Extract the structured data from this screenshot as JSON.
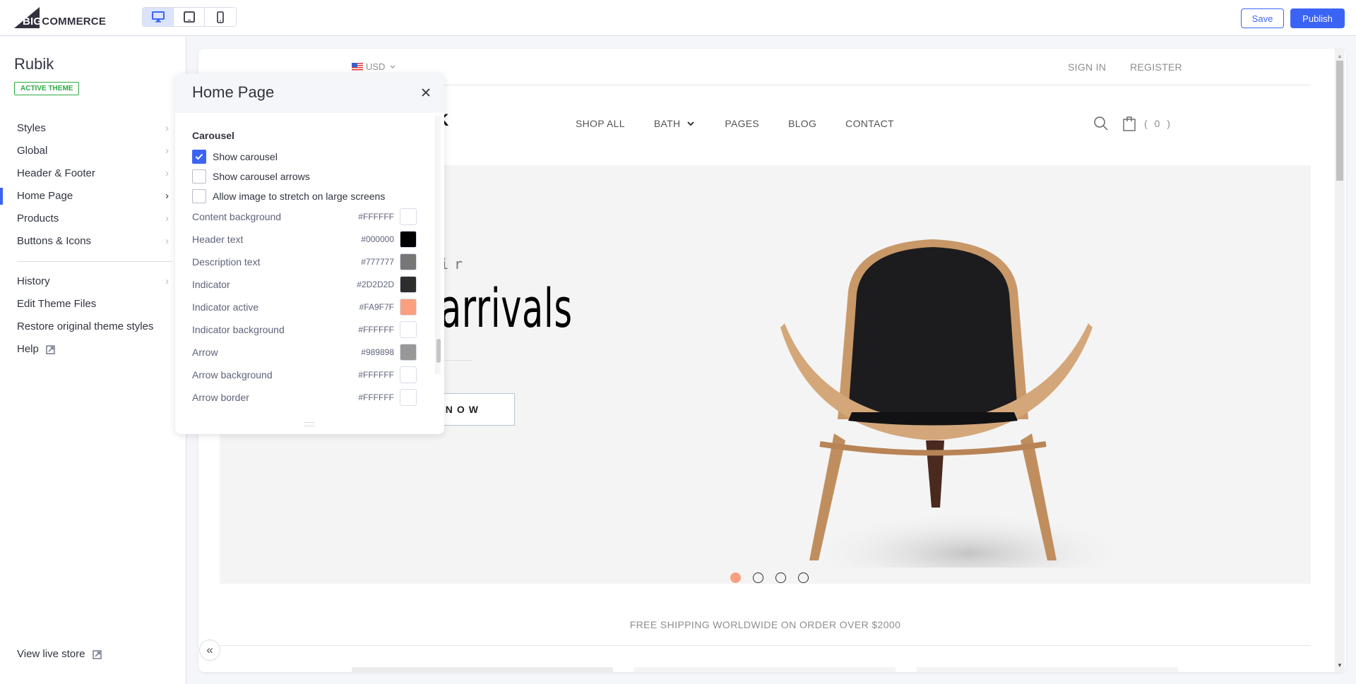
{
  "topbar": {
    "brand": {
      "big": "BIG",
      "rest": "COMMERCE"
    },
    "devices": [
      {
        "name": "desktop",
        "icon": "desktop-icon",
        "active": true
      },
      {
        "name": "tablet",
        "icon": "tablet-icon",
        "active": false
      },
      {
        "name": "mobile",
        "icon": "mobile-icon",
        "active": false
      }
    ],
    "save_label": "Save",
    "publish_label": "Publish",
    "accent": "#3C64F4"
  },
  "sidebar": {
    "theme_name": "Rubik",
    "theme_badge": "ACTIVE THEME",
    "items": [
      {
        "label": "Styles"
      },
      {
        "label": "Global"
      },
      {
        "label": "Header & Footer"
      },
      {
        "label": "Home Page",
        "active": true
      },
      {
        "label": "Products"
      },
      {
        "label": "Buttons & Icons"
      }
    ],
    "secondary": [
      {
        "label": "History",
        "chevron": true
      },
      {
        "label": "Edit Theme Files"
      },
      {
        "label": "Restore original theme styles"
      },
      {
        "label": "Help",
        "external": true
      }
    ],
    "view_live": "View live store"
  },
  "panel": {
    "title": "Home Page",
    "section": "Carousel",
    "checkboxes": [
      {
        "label": "Show carousel",
        "checked": true
      },
      {
        "label": "Show carousel arrows",
        "checked": false
      },
      {
        "label": "Allow image to stretch on large screens",
        "checked": false
      }
    ],
    "colors": [
      {
        "label": "Content background",
        "hex": "#FFFFFF"
      },
      {
        "label": "Header text",
        "hex": "#000000"
      },
      {
        "label": "Description text",
        "hex": "#777777"
      },
      {
        "label": "Indicator",
        "hex": "#2D2D2D"
      },
      {
        "label": "Indicator active",
        "hex": "#FA9F7F"
      },
      {
        "label": "Indicator background",
        "hex": "#FFFFFF"
      },
      {
        "label": "Arrow",
        "hex": "#989898"
      },
      {
        "label": "Arrow background",
        "hex": "#FFFFFF"
      },
      {
        "label": "Arrow border",
        "hex": "#FFFFFF"
      }
    ]
  },
  "store": {
    "currency": "USD",
    "sign_in": "SIGN IN",
    "register": "REGISTER",
    "logo_fragment": "K",
    "nav": [
      "SHOP ALL",
      "BATH",
      "PAGES",
      "BLOG",
      "CONTACT"
    ],
    "cart_count": "( 0 )",
    "hero": {
      "subtitle_fragment": "ir",
      "title_fragment": "arrivals",
      "button_fragment": "NOW",
      "slides": 4,
      "active_slide": 1
    },
    "shipping_text": "FREE SHIPPING WORLDWIDE ON ORDER OVER $2000"
  }
}
